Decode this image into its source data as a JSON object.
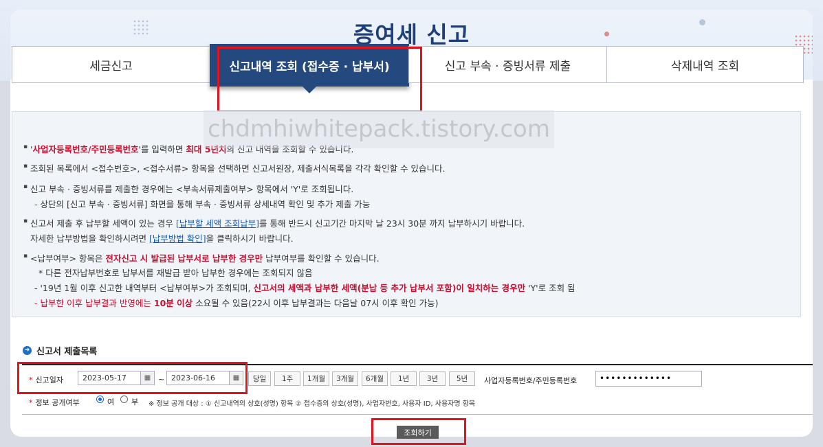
{
  "header": {
    "title": "증여세 신고"
  },
  "tabs": [
    {
      "label": "세금신고",
      "active": false
    },
    {
      "label": "신고내역 조회 (접수증 · 납부서)",
      "active": true
    },
    {
      "label": "신고 부속 · 증빙서류 제출",
      "active": false
    },
    {
      "label": "삭제내역 조회",
      "active": false
    }
  ],
  "watermark": "chdmhiwhitepack.tistory.com",
  "info": {
    "l1": {
      "a": "'",
      "b": "사업자등록번호/주민등록번호",
      "c": "'를 입력하면 ",
      "d": "최대 5년치",
      "e": "의 신고 내역을 조회할 수 있습니다."
    },
    "l2": "조회된 목록에서 <접수번호>, <접수서류> 항목을 선택하면 신고서원장, 제출서식목록을 각각 확인할 수 있습니다.",
    "l3": "신고 부속 · 증빙서류를 제출한 경우에는 <부속서류제출여부> 항목에서 'Y'로 조회됩니다.",
    "l4": "- 상단의 [신고 부속 · 증빙서류] 화면을 통해 부속 · 증빙서류 상세내역 확인 및 추가 제출 가능",
    "l5": {
      "a": "신고서 제출 후 납부할 세액이 있는 경우 ",
      "link": "[납부할 세액 조회납부]",
      "b": "를 통해 반드시 신고기간 마지막 날 23시 30분 까지 납부하시기 바랍니다."
    },
    "l6": {
      "a": "자세한 납부방법을 확인하시려면 ",
      "link": "[납부방법 확인]",
      "b": "을 클릭하시기 바랍니다."
    },
    "l7": {
      "a": "<납부여부> 항목은 ",
      "b": "전자신고 시 발급된 납부서로 납부한 경우만",
      "c": " 납부여부를 확인할 수 있습니다."
    },
    "l8": "* 다른 전자납부번호로 납부서를 재발급 받아 납부한 경우에는 조회되지 않음",
    "l9": {
      "a": "- '19년 1월 이후 신고한 내역부터 <납부여부>가 조회되며, ",
      "b": "신고서의 세액과 납부한 세액(분납 등 추가 납부서 포함)이 일치하는 경우만",
      "c": " 'Y'로 조회 됨"
    },
    "l10": {
      "a": "- 납부한 이후 납부결과 반영에는 ",
      "b": "10분 이상",
      "c": " 소요될 수 있음(22시 이후 납부결과는 다음날 07시 이후 확인 가능)"
    }
  },
  "section": {
    "title": "신고서 제출목록"
  },
  "form": {
    "date_label": "신고일자",
    "date_from": "2023-05-17",
    "date_sep": "~",
    "date_to": "2023-06-16",
    "periods": [
      "당일",
      "1주",
      "1개월",
      "3개월",
      "6개월",
      "1년",
      "3년",
      "5년"
    ],
    "id_label": "사업자등록번호/주민등록번호",
    "id_value": "•••••••••••••",
    "public_label": "정보 공개여부",
    "opt_yes": "여",
    "opt_no": "부",
    "public_note": "※ 정보 공개 대상 : ① 신고내역의 상호(성명) 항목 ② 접수증의 상호(성명), 사업자번호, 사용자 ID, 사용자명 항목"
  },
  "search_button": "조회하기"
}
